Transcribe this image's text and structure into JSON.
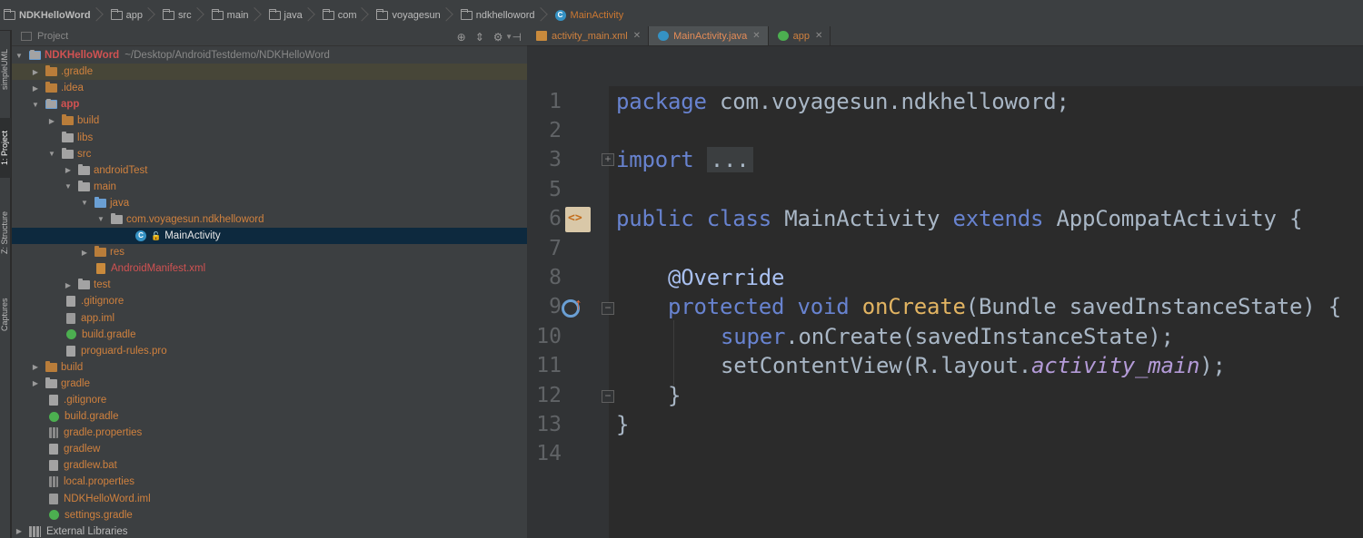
{
  "breadcrumb": {
    "items": [
      "NDKHelloWord",
      "app",
      "src",
      "main",
      "java",
      "com",
      "voyagesun",
      "ndkhelloword",
      "MainActivity"
    ]
  },
  "toolstrip": {
    "tabs": [
      "simpleUML",
      "1: Project",
      "Z: Structure",
      "Captures"
    ]
  },
  "project_panel": {
    "view_selector": "Project",
    "root_name": "NDKHelloWord",
    "root_path": "~/Desktop/AndroidTestdemo/NDKHelloWord",
    "tree": [
      {
        "label": "NDKHelloWord"
      },
      {
        "label": ".gradle"
      },
      {
        "label": ".idea"
      },
      {
        "label": "app"
      },
      {
        "label": "build"
      },
      {
        "label": "libs"
      },
      {
        "label": "src"
      },
      {
        "label": "androidTest"
      },
      {
        "label": "main"
      },
      {
        "label": "java"
      },
      {
        "label": "com.voyagesun.ndkhelloword"
      },
      {
        "label": "MainActivity"
      },
      {
        "label": "res"
      },
      {
        "label": "AndroidManifest.xml"
      },
      {
        "label": "test"
      },
      {
        "label": ".gitignore"
      },
      {
        "label": "app.iml"
      },
      {
        "label": "build.gradle"
      },
      {
        "label": "proguard-rules.pro"
      },
      {
        "label": "build"
      },
      {
        "label": "gradle"
      },
      {
        "label": ".gitignore"
      },
      {
        "label": "build.gradle"
      },
      {
        "label": "gradle.properties"
      },
      {
        "label": "gradlew"
      },
      {
        "label": "gradlew.bat"
      },
      {
        "label": "local.properties"
      },
      {
        "label": "NDKHelloWord.iml"
      },
      {
        "label": "settings.gradle"
      },
      {
        "label": "External Libraries"
      }
    ]
  },
  "editor": {
    "tabs": [
      {
        "label": "activity_main.xml"
      },
      {
        "label": "MainActivity.java",
        "active": true
      },
      {
        "label": "app"
      }
    ],
    "line_numbers": [
      "1",
      "2",
      "3",
      "5",
      "6",
      "7",
      "8",
      "9",
      "10",
      "11",
      "12",
      "13",
      "14"
    ],
    "code": {
      "l1_kw": "package",
      "l1_rest": " com.voyagesun.ndkhelloword;",
      "l3_kw": "import",
      "l3_fold": "...",
      "l6_kw1": "public class",
      "l6_name": " MainActivity ",
      "l6_kw2": "extends",
      "l6_rest": " AppCompatActivity {",
      "l8_ann": "@Override",
      "l9_kw": "protected void",
      "l9_fn": " onCreate",
      "l9_rest": "(Bundle savedInstanceState) {",
      "l10_kw": "super",
      "l10_rest": ".onCreate(savedInstanceState);",
      "l11_pre": "setContentView(R.layout.",
      "l11_it": "activity_main",
      "l11_post": ");",
      "l12": "}",
      "l13": "}"
    }
  },
  "colors": {
    "keyword": "#6883d0",
    "function": "#e2b462",
    "active_tab_text": "#e58c57",
    "selection": "#0d293e"
  }
}
